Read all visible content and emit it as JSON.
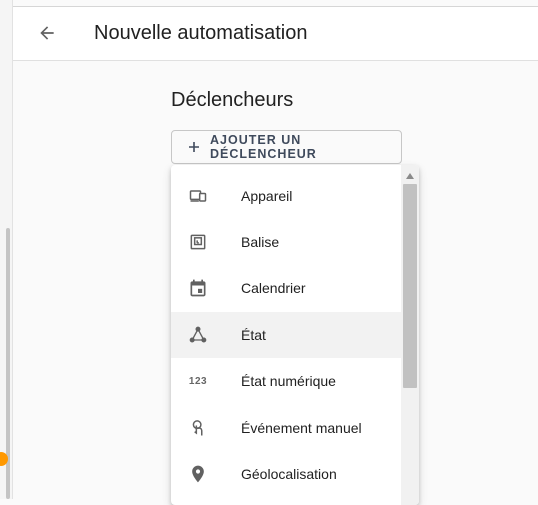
{
  "header": {
    "title": "Nouvelle automatisation"
  },
  "section": {
    "title": "Déclencheurs"
  },
  "add_trigger": {
    "label": "AJOUTER UN DÉCLENCHEUR"
  },
  "menu": {
    "items": [
      {
        "label": "Appareil",
        "icon": "device-icon"
      },
      {
        "label": "Balise",
        "icon": "tag-icon"
      },
      {
        "label": "Calendrier",
        "icon": "calendar-icon"
      },
      {
        "label": "État",
        "icon": "state-icon",
        "highlighted": true
      },
      {
        "label": "État numérique",
        "icon": "numeric-state-icon",
        "icon_text": "123"
      },
      {
        "label": "Événement manuel",
        "icon": "touch-icon"
      },
      {
        "label": "Géolocalisation",
        "icon": "location-pin-icon"
      }
    ]
  },
  "colors": {
    "accent": "#ff9800",
    "text": "#212121",
    "button_text": "#3f4a5c",
    "icon": "#616161"
  }
}
